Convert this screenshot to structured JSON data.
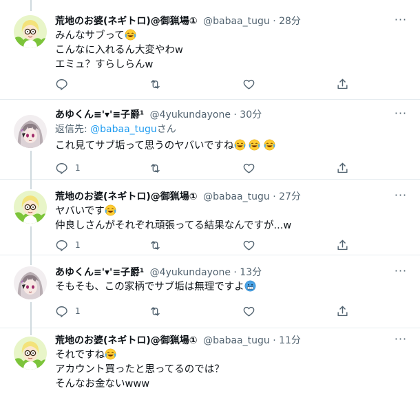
{
  "colors": {
    "text": "#0f1419",
    "secondary": "#536471",
    "link": "#1d9bf0",
    "divider": "#e6ecf0",
    "thread_line": "#cfd9de"
  },
  "tweets": [
    {
      "name": "荒地のお婆(ネギトロ)@御猟場①",
      "handle": "@babaa_tugu",
      "time": "· 28分",
      "reply_prefix": "",
      "reply_link": "",
      "reply_suffix": "",
      "lines": [
        "みんなサブって",
        "こんなに入れるん大変やわw",
        "エミュ？すらしらんw"
      ],
      "reply_count": "",
      "avatar": "old-lady-with-glasses-avatar"
    },
    {
      "name": "あゆくん≡'▾'≡子爵¹",
      "handle": "@4yukundayone",
      "time": "· 30分",
      "reply_prefix": "返信先:",
      "reply_link": "@babaa_tugu",
      "reply_suffix": "さん",
      "lines": [
        "これ見てサブ垢って思うのヤバいですね"
      ],
      "reply_count": "1",
      "avatar": "anime-character-avatar"
    },
    {
      "name": "荒地のお婆(ネギトロ)@御猟場①",
      "handle": "@babaa_tugu",
      "time": "· 27分",
      "reply_prefix": "",
      "reply_link": "",
      "reply_suffix": "",
      "lines": [
        "ヤバいです",
        "仲良しさんがそれぞれ頑張ってる結果なんですが...w"
      ],
      "reply_count": "1",
      "avatar": "old-lady-with-glasses-avatar"
    },
    {
      "name": "あゆくん≡'▾'≡子爵¹",
      "handle": "@4yukundayone",
      "time": "· 13分",
      "reply_prefix": "",
      "reply_link": "",
      "reply_suffix": "",
      "lines": [
        "そもそも、この家柄でサブ垢は無理ですよ"
      ],
      "reply_count": "1",
      "avatar": "anime-character-avatar"
    },
    {
      "name": "荒地のお婆(ネギトロ)@御猟場①",
      "handle": "@babaa_tugu",
      "time": "· 11分",
      "reply_prefix": "",
      "reply_link": "",
      "reply_suffix": "",
      "lines": [
        "それですね",
        "アカウント買ったと思ってるのでは？",
        "そんなお金ないwww"
      ],
      "reply_count": "",
      "avatar": "old-lady-with-glasses-avatar"
    }
  ]
}
